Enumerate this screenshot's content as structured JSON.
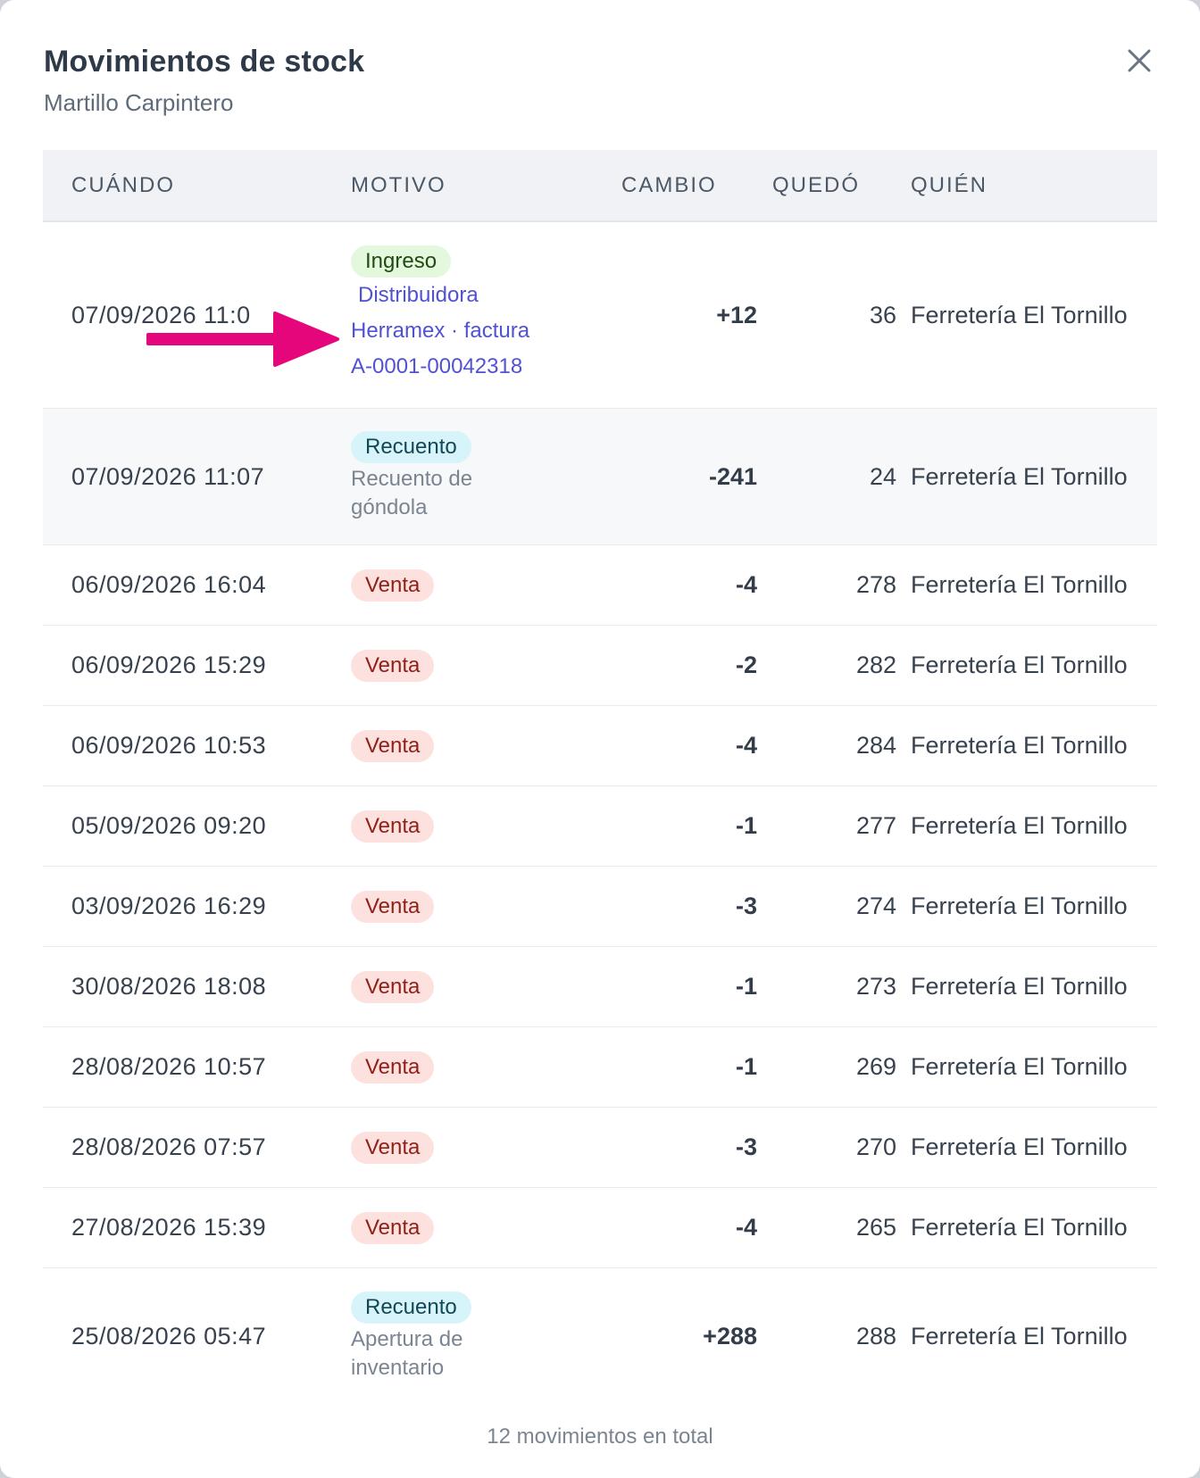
{
  "modal": {
    "title": "Movimientos de stock",
    "subtitle": "Martillo Carpintero",
    "close_icon": "close-icon"
  },
  "table": {
    "headers": {
      "when": "CUÁNDO",
      "motivo": "MOTIVO",
      "change": "CAMBIO",
      "left": "QUEDÓ",
      "who": "QUIÉN"
    },
    "rows": [
      {
        "when": "07/09/2026 11:0",
        "badge": "Ingreso",
        "type": "ingreso",
        "note_line1": "Distribuidora",
        "note_line2": "Herramex · factura",
        "note_line3": "A-0001-00042318",
        "change": "+12",
        "left": "36",
        "who": "Ferretería El Tornillo"
      },
      {
        "when": "07/09/2026 11:07",
        "badge": "Recuento",
        "type": "recuento",
        "note_line1": "Recuento de",
        "note_line2": "góndola",
        "change": "-241",
        "left": "24",
        "who": "Ferretería El Tornillo"
      },
      {
        "when": "06/09/2026 16:04",
        "badge": "Venta",
        "type": "venta",
        "change": "-4",
        "left": "278",
        "who": "Ferretería El Tornillo"
      },
      {
        "when": "06/09/2026 15:29",
        "badge": "Venta",
        "type": "venta",
        "change": "-2",
        "left": "282",
        "who": "Ferretería El Tornillo"
      },
      {
        "when": "06/09/2026 10:53",
        "badge": "Venta",
        "type": "venta",
        "change": "-4",
        "left": "284",
        "who": "Ferretería El Tornillo"
      },
      {
        "when": "05/09/2026 09:20",
        "badge": "Venta",
        "type": "venta",
        "change": "-1",
        "left": "277",
        "who": "Ferretería El Tornillo"
      },
      {
        "when": "03/09/2026 16:29",
        "badge": "Venta",
        "type": "venta",
        "change": "-3",
        "left": "274",
        "who": "Ferretería El Tornillo"
      },
      {
        "when": "30/08/2026 18:08",
        "badge": "Venta",
        "type": "venta",
        "change": "-1",
        "left": "273",
        "who": "Ferretería El Tornillo"
      },
      {
        "when": "28/08/2026 10:57",
        "badge": "Venta",
        "type": "venta",
        "change": "-1",
        "left": "269",
        "who": "Ferretería El Tornillo"
      },
      {
        "when": "28/08/2026 07:57",
        "badge": "Venta",
        "type": "venta",
        "change": "-3",
        "left": "270",
        "who": "Ferretería El Tornillo"
      },
      {
        "when": "27/08/2026 15:39",
        "badge": "Venta",
        "type": "venta",
        "change": "-4",
        "left": "265",
        "who": "Ferretería El Tornillo"
      },
      {
        "when": "25/08/2026 05:47",
        "badge": "Recuento",
        "type": "recuento",
        "note_line1": "Apertura de",
        "note_line2": "inventario",
        "change": "+288",
        "left": "288",
        "who": "Ferretería El Tornillo"
      }
    ]
  },
  "footer": "12 movimientos en total",
  "colors": {
    "arrow": "#e5067c",
    "link": "#5151d4",
    "ingreso_bg": "#e3f8dc",
    "recuento_bg": "#d7f4fb",
    "venta_bg": "#fde1df"
  }
}
